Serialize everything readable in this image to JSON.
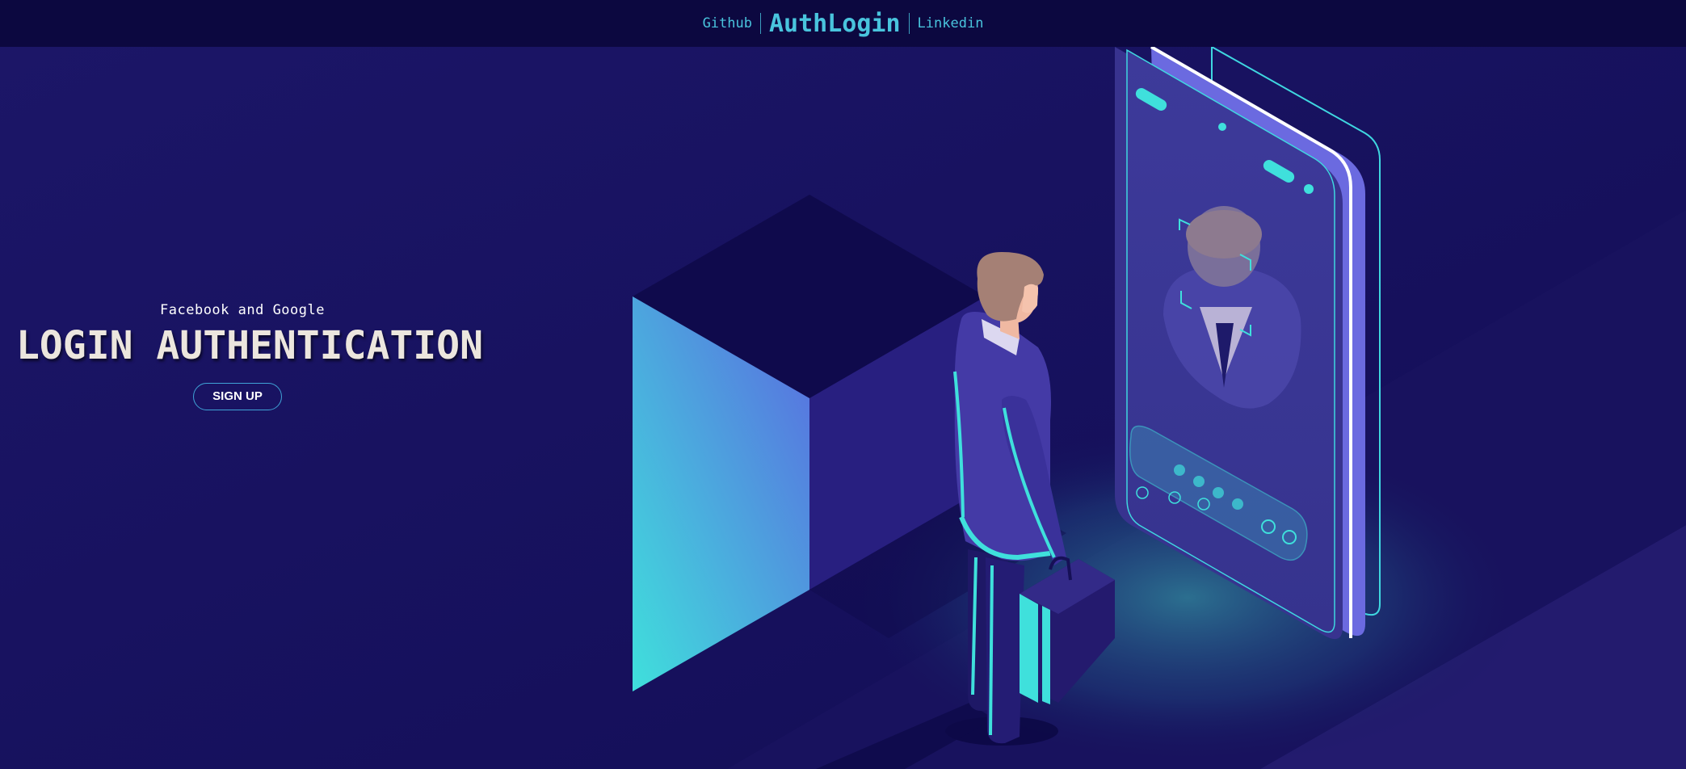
{
  "header": {
    "github_label": "Github",
    "brand": "AuthLogin",
    "linkedin_label": "Linkedin"
  },
  "hero": {
    "subtitle": "Facebook and Google",
    "title": "LOGIN AUTHENTICATION",
    "signup_label": "SIGN UP"
  },
  "colors": {
    "background": "#14105a",
    "header": "#0c0840",
    "accent": "#49c4dd",
    "title": "#ece6de"
  },
  "illustration": {
    "icons": [
      "isometric-cube-icon",
      "businessman-icon",
      "briefcase-icon",
      "smartphone-face-id-icon"
    ]
  }
}
